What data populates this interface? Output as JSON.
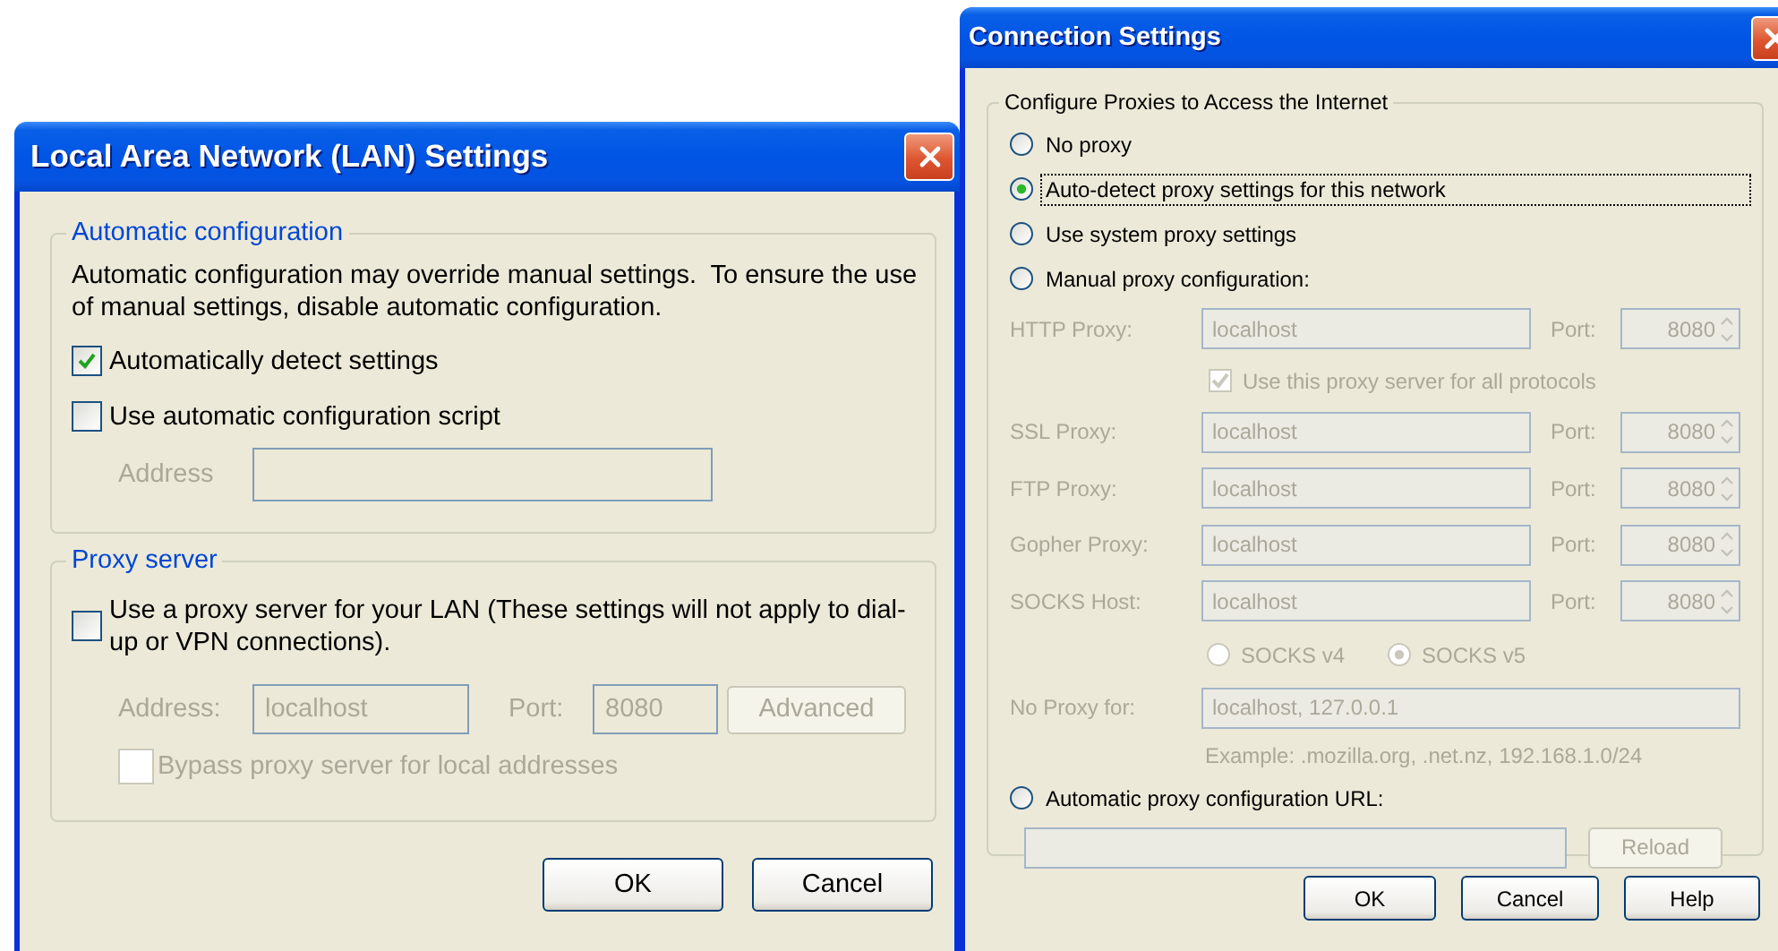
{
  "lan_window": {
    "title": "Local Area Network (LAN) Settings",
    "automatic_configuration": {
      "legend": "Automatic configuration",
      "description": "Automatic configuration may override manual settings.  To ensure the use of manual settings, disable automatic configuration.",
      "checkboxes": [
        {
          "label": "Automatically detect settings",
          "checked": true
        },
        {
          "label": "Use automatic configuration script",
          "checked": false
        }
      ],
      "address": {
        "label": "Address",
        "disabled": true
      }
    },
    "proxy_server": {
      "legend": "Proxy server",
      "use_proxy": {
        "label": "Use a proxy server for your LAN (These settings will not apply to dial-up or VPN connections).",
        "checked": false
      },
      "address": {
        "label": "Address:",
        "value": "localhost",
        "disabled": true
      },
      "port": {
        "label": "Port:",
        "value": "8080",
        "disabled": true
      },
      "advanced": {
        "label": "Advanced",
        "disabled": true
      },
      "bypass": {
        "label": "Bypass proxy server for local addresses",
        "checked": false,
        "disabled": true
      }
    },
    "buttons": [
      "OK",
      "Cancel"
    ]
  },
  "connection_window": {
    "title": "Connection Settings",
    "legend": "Configure Proxies to Access the Internet",
    "modes": [
      {
        "kind": "plain",
        "label": "No proxy",
        "selected": false,
        "focused": false
      },
      {
        "kind": "plain",
        "label": "Auto-detect proxy settings for this network",
        "selected": true,
        "focused": true
      },
      {
        "kind": "plain",
        "label": "Use system proxy settings",
        "selected": false,
        "focused": false
      },
      {
        "kind": "manual",
        "label": "Manual proxy configuration:",
        "selected": false,
        "focused": false
      },
      {
        "kind": "url",
        "label": "Automatic proxy configuration URL:",
        "selected": false,
        "focused": false
      }
    ],
    "manual": {
      "disabled": true,
      "proxies": [
        {
          "label": "HTTP Proxy:",
          "host": "localhost",
          "port_label": "Port:",
          "port": "8080"
        },
        {
          "label": "SSL Proxy:",
          "host": "localhost",
          "port_label": "Port:",
          "port": "8080"
        },
        {
          "label": "FTP Proxy:",
          "host": "localhost",
          "port_label": "Port:",
          "port": "8080"
        },
        {
          "label": "Gopher Proxy:",
          "host": "localhost",
          "port_label": "Port:",
          "port": "8080"
        },
        {
          "label": "SOCKS Host:",
          "host": "localhost",
          "port_label": "Port:",
          "port": "8080"
        }
      ],
      "share": {
        "label": "Use this proxy server for all protocols",
        "checked": true
      },
      "socks_versions": [
        {
          "label": "SOCKS v4",
          "selected": false
        },
        {
          "label": "SOCKS v5",
          "selected": true
        }
      ],
      "no_proxy": {
        "label": "No Proxy for:",
        "value": "localhost, 127.0.0.1"
      },
      "example": "Example: .mozilla.org, .net.nz, 192.168.1.0/24"
    },
    "url": {
      "disabled": true,
      "reload": "Reload"
    },
    "buttons": [
      "OK",
      "Cancel",
      "Help"
    ]
  }
}
